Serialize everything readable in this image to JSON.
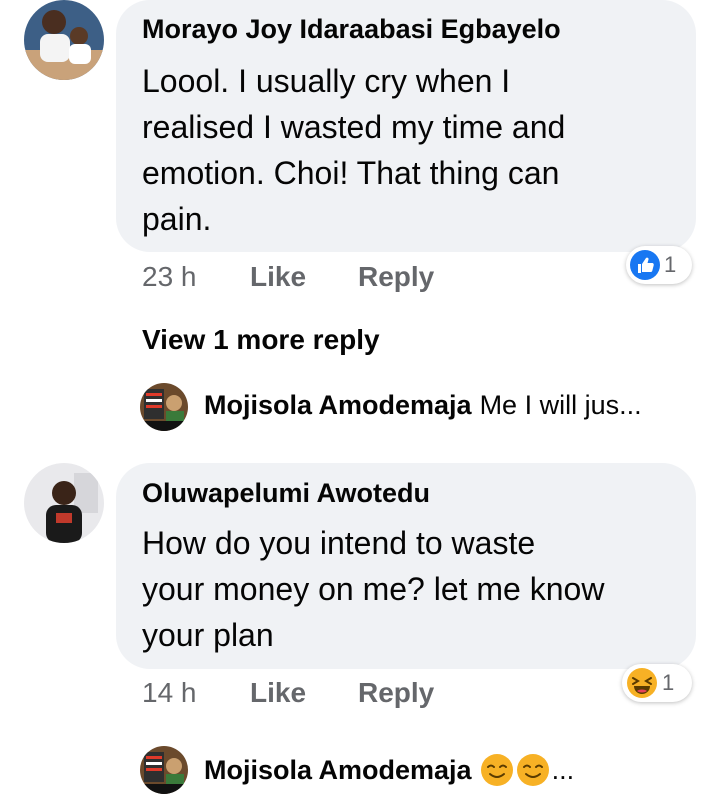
{
  "comments": [
    {
      "author": "Morayo Joy Idaraabasi Egbayelo",
      "text_lines": [
        "Loool. I usually cry when I",
        "realised I wasted my time and",
        "emotion. Choi! That thing can",
        "pain."
      ],
      "time": "23 h",
      "like_label": "Like",
      "reply_label": "Reply",
      "reaction": {
        "type": "like-icon",
        "count": "1",
        "color": "#1877f2"
      }
    },
    {
      "author": "Oluwapelumi Awotedu",
      "text_lines": [
        "How do you intend to waste",
        "your money on me? let me know",
        "your plan"
      ],
      "time": "14 h",
      "like_label": "Like",
      "reply_label": "Reply",
      "reaction": {
        "type": "laughing-emoji-icon",
        "count": "1",
        "color": "#f7b125"
      }
    }
  ],
  "view_more": "View 1 more reply",
  "replies": [
    {
      "author": "Mojisola Amodemaja",
      "preview": "Me I will jus..."
    },
    {
      "author": "Mojisola Amodemaja",
      "preview": "..."
    }
  ]
}
